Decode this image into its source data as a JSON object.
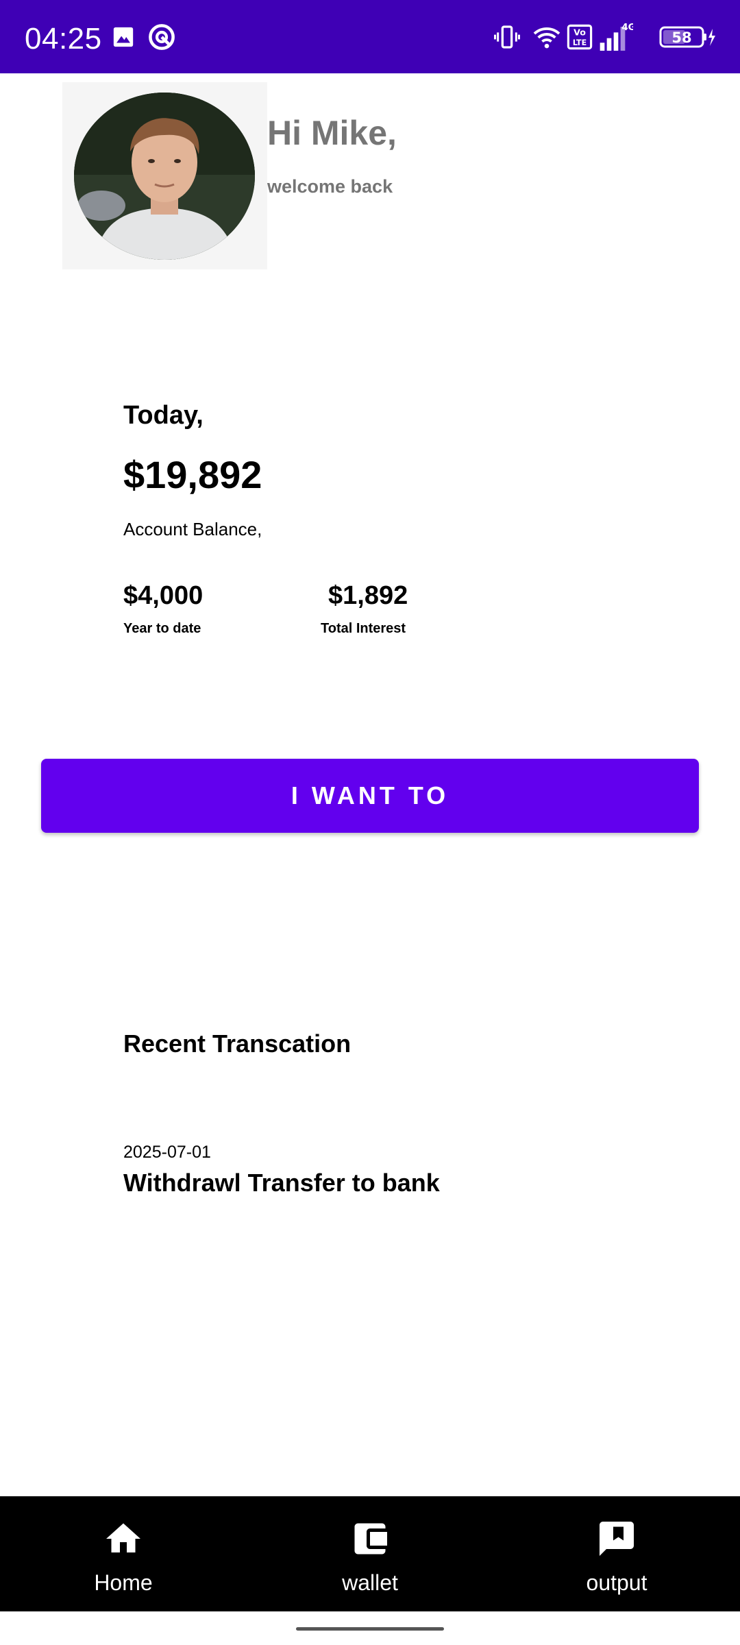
{
  "status_bar": {
    "time": "04:25",
    "battery": "58",
    "network": "4G",
    "volte": "Vo LTE",
    "icons": [
      "gallery-icon",
      "cast-icon",
      "vibrate-icon",
      "wifi-icon",
      "volte-icon",
      "signal-icon",
      "battery-icon",
      "charging-icon"
    ],
    "background": "#3F00B5"
  },
  "header": {
    "greeting": "Hi Mike,",
    "subtitle": "welcome back"
  },
  "summary": {
    "today_label": "Today,",
    "balance": "$19,892",
    "balance_label": "Account Balance,",
    "year_to_date": {
      "value": "$4,000",
      "label": "Year to date"
    },
    "total_interest": {
      "value": "$1,892",
      "label": "Total Interest"
    }
  },
  "action_button": {
    "label": "I WANT TO",
    "color": "#6200EE"
  },
  "transactions": {
    "title": "Recent Transcation",
    "items": [
      {
        "date": "2025-07-01",
        "description": "Withdrawl Transfer to bank"
      }
    ]
  },
  "bottom_nav": {
    "items": [
      {
        "label": "Home",
        "icon": "home-icon"
      },
      {
        "label": "wallet",
        "icon": "wallet-icon"
      },
      {
        "label": "output",
        "icon": "feedback-icon"
      }
    ]
  }
}
